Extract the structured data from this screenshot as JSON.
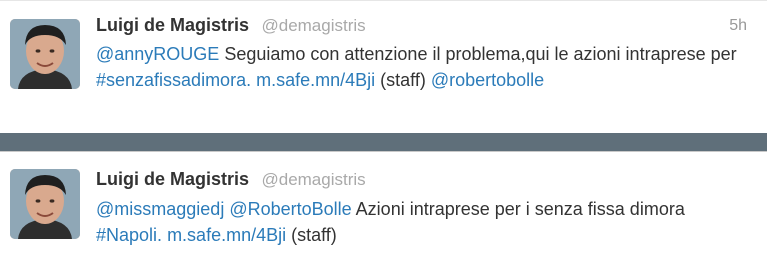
{
  "tweets": [
    {
      "author_name": "Luigi de Magistris",
      "author_handle": "@demagistris",
      "time": "5h",
      "segments": [
        {
          "text": "@annyROUGE",
          "link": true
        },
        {
          "text": " Seguiamo con attenzione il problema,qui le azioni intraprese per ",
          "link": false
        },
        {
          "text": "#senzafissadimora.",
          "link": true
        },
        {
          "text": " ",
          "link": false
        },
        {
          "text": "m.safe.mn/4Bji",
          "link": true
        },
        {
          "text": " (staff) ",
          "link": false
        },
        {
          "text": "@robertobolle",
          "link": true
        }
      ]
    },
    {
      "author_name": "Luigi de Magistris",
      "author_handle": "@demagistris",
      "time": "",
      "segments": [
        {
          "text": "@missmaggiedj",
          "link": true
        },
        {
          "text": " ",
          "link": false
        },
        {
          "text": "@RobertoBolle",
          "link": true
        },
        {
          "text": " Azioni intraprese per i senza fissa dimora ",
          "link": false
        },
        {
          "text": "#Napoli.",
          "link": true
        },
        {
          "text": " ",
          "link": false
        },
        {
          "text": "m.safe.mn/4Bji",
          "link": true
        },
        {
          "text": " (staff)",
          "link": false
        }
      ]
    }
  ],
  "colors": {
    "link": "#2b7bb9",
    "text": "#333333",
    "muted": "#a9a9a9",
    "separator": "#5f6f7a"
  },
  "icons": {
    "avatar": "profile-photo"
  }
}
